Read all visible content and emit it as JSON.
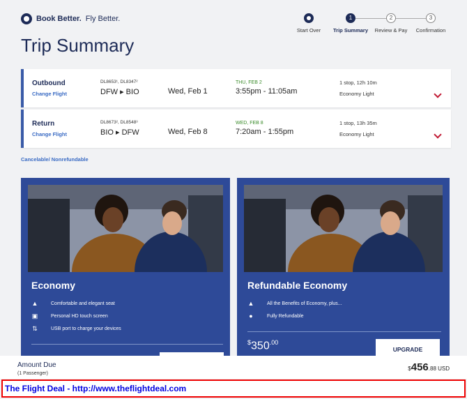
{
  "brand": {
    "bold": "Book Better.",
    "rest": " Fly Better."
  },
  "title": "Trip Summary",
  "steps": [
    {
      "num": "",
      "label": "Start Over"
    },
    {
      "num": "1",
      "label": "Trip Summary"
    },
    {
      "num": "2",
      "label": "Review & Pay"
    },
    {
      "num": "3",
      "label": "Confirmation"
    }
  ],
  "outbound": {
    "dir": "Outbound",
    "change": "Change Flight",
    "nums": "DL8653¹, DL8347²",
    "route": "DFW ▸ BIO",
    "date": "Wed, Feb 1",
    "arrive_note": "THU, FEB 2",
    "times": "3:55pm - 11:05am",
    "stops": "1 stop, 12h 10m",
    "cabin": "Economy Light"
  },
  "return": {
    "dir": "Return",
    "change": "Change Flight",
    "nums": "DL8673², DL8548³",
    "route": "BIO ▸ DFW",
    "date": "Wed, Feb 8",
    "arrive_note": "WED, FEB 8",
    "times": "7:20am - 1:55pm",
    "stops": "1 stop, 13h 35m",
    "cabin": "Economy Light"
  },
  "cancel_note": "Cancelable/ Nonrefundable",
  "economy": {
    "title": "Economy",
    "features": [
      "Comfortable and elegant seat",
      "Personal HD touch screen",
      "USB port to charge your devices"
    ]
  },
  "refundable": {
    "title": "Refundable Economy",
    "features": [
      "All the Benefits of Economy, plus...",
      "Fully Refundable"
    ],
    "price_sym": "$",
    "price_int": "350",
    "price_dec": ".00",
    "upgrade": "UPGRADE"
  },
  "footer": {
    "label": "Amount Due",
    "passengers": "(1 Passenger)",
    "sym": "$",
    "int": "456",
    "dec": ".88 USD"
  },
  "banner": "The Flight Deal - http://www.theflightdeal.com"
}
